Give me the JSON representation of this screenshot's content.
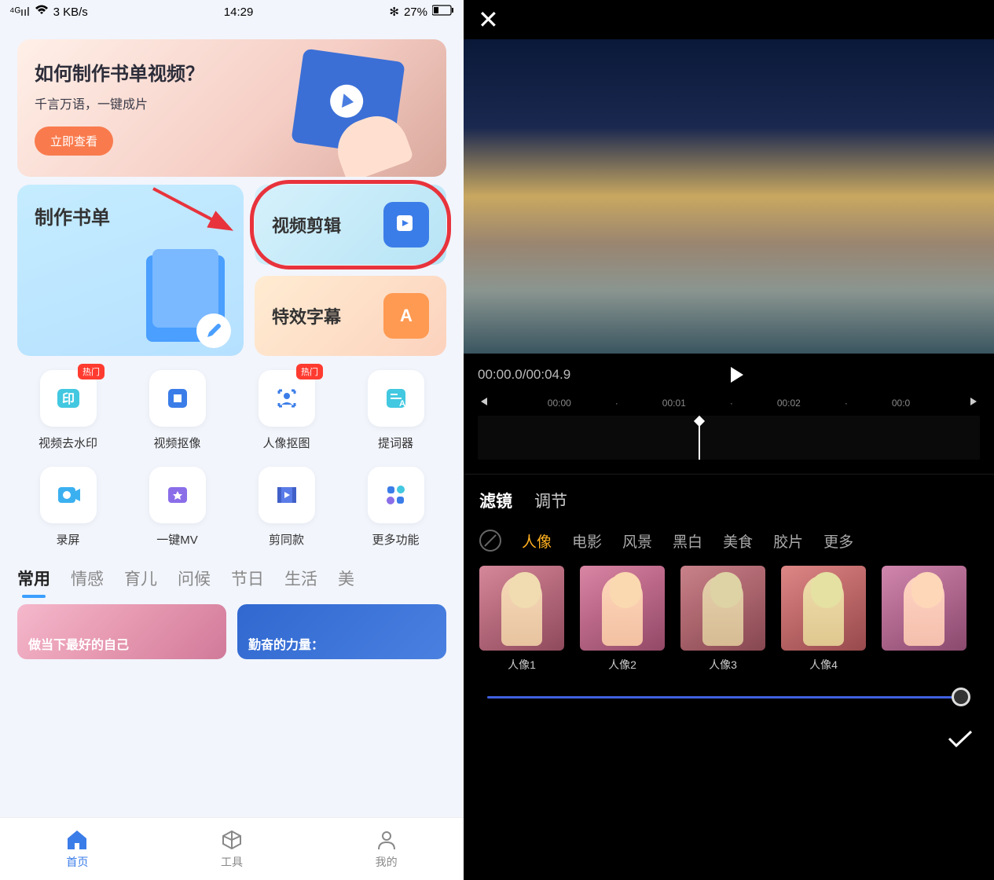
{
  "left": {
    "status": {
      "signal": "4G",
      "speed": "3 KB/s",
      "time": "14:29",
      "bt": "✻",
      "battery": "27%"
    },
    "banner": {
      "title": "如何制作书单视频？",
      "subtitle": "千言万语，一键成片",
      "button": "立即查看"
    },
    "cards": {
      "booklist": "制作书单",
      "video_edit": "视频剪辑",
      "subtitle": "特效字幕"
    },
    "grid": [
      {
        "label": "视频去水印",
        "badge": "热门"
      },
      {
        "label": "视频抠像",
        "badge": null
      },
      {
        "label": "人像抠图",
        "badge": "热门"
      },
      {
        "label": "提词器",
        "badge": null
      },
      {
        "label": "录屏",
        "badge": null
      },
      {
        "label": "一键MV",
        "badge": null
      },
      {
        "label": "剪同款",
        "badge": null
      },
      {
        "label": "更多功能",
        "badge": null
      }
    ],
    "tabs": [
      "常用",
      "情感",
      "育儿",
      "问候",
      "节日",
      "生活",
      "美"
    ],
    "templates": {
      "t1": "做当下最好的自己",
      "t2": "勤奋的力量："
    },
    "nav": [
      {
        "label": "首页"
      },
      {
        "label": "工具"
      },
      {
        "label": "我的"
      }
    ]
  },
  "right": {
    "time": {
      "current": "00:00.0",
      "total": "00:04.9"
    },
    "ticks": [
      "00:00",
      "00:01",
      "00:02",
      "00:0"
    ],
    "tabs": {
      "filter": "滤镜",
      "adjust": "调节"
    },
    "cats": [
      "人像",
      "电影",
      "风景",
      "黑白",
      "美食",
      "胶片",
      "更多"
    ],
    "filters": [
      "人像1",
      "人像2",
      "人像3",
      "人像4"
    ]
  }
}
